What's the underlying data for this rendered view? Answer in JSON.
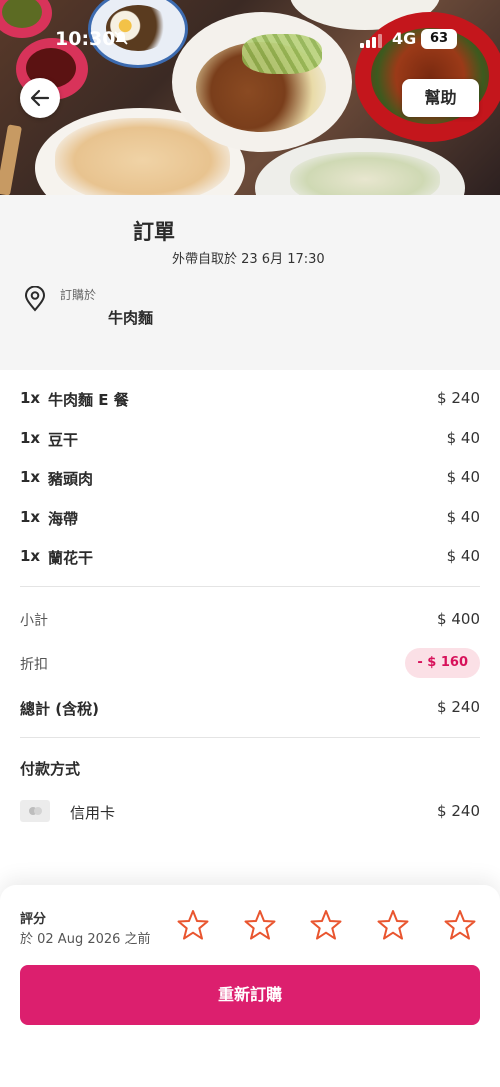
{
  "status_bar": {
    "time": "10:30",
    "network": "4G",
    "battery": "63"
  },
  "header": {
    "help_label": "幫助"
  },
  "order": {
    "title": "訂單",
    "pickup_info": "外帶自取於 23 6月 17:30",
    "ordered_at_label": "訂購於",
    "restaurant": "牛肉麵"
  },
  "items": [
    {
      "qty": "1x",
      "name": "牛肉麵 E 餐",
      "price": "$ 240"
    },
    {
      "qty": "1x",
      "name": "豆干",
      "price": "$ 40"
    },
    {
      "qty": "1x",
      "name": "豬頭肉",
      "price": "$ 40"
    },
    {
      "qty": "1x",
      "name": "海帶",
      "price": "$ 40"
    },
    {
      "qty": "1x",
      "name": "蘭花干",
      "price": "$ 40"
    }
  ],
  "totals": {
    "subtotal_label": "小計",
    "subtotal": "$ 400",
    "discount_label": "折扣",
    "discount": "- $ 160",
    "total_label": "總計 (含稅)",
    "total": "$ 240"
  },
  "payment": {
    "title": "付款方式",
    "method": "信用卡",
    "amount": "$ 240"
  },
  "rating": {
    "label": "評分",
    "deadline": "於 02 Aug 2026 之前",
    "stars": 5,
    "selected": 0
  },
  "reorder_label": "重新訂購",
  "colors": {
    "brand": "#dc1f6e",
    "discount_text": "#d7115a",
    "discount_bg": "#fbe0e6",
    "star": "#e9552f"
  },
  "icons": [
    "back-arrow-icon",
    "location-pin-icon",
    "credit-card-icon",
    "star-icon",
    "mute-icon"
  ]
}
